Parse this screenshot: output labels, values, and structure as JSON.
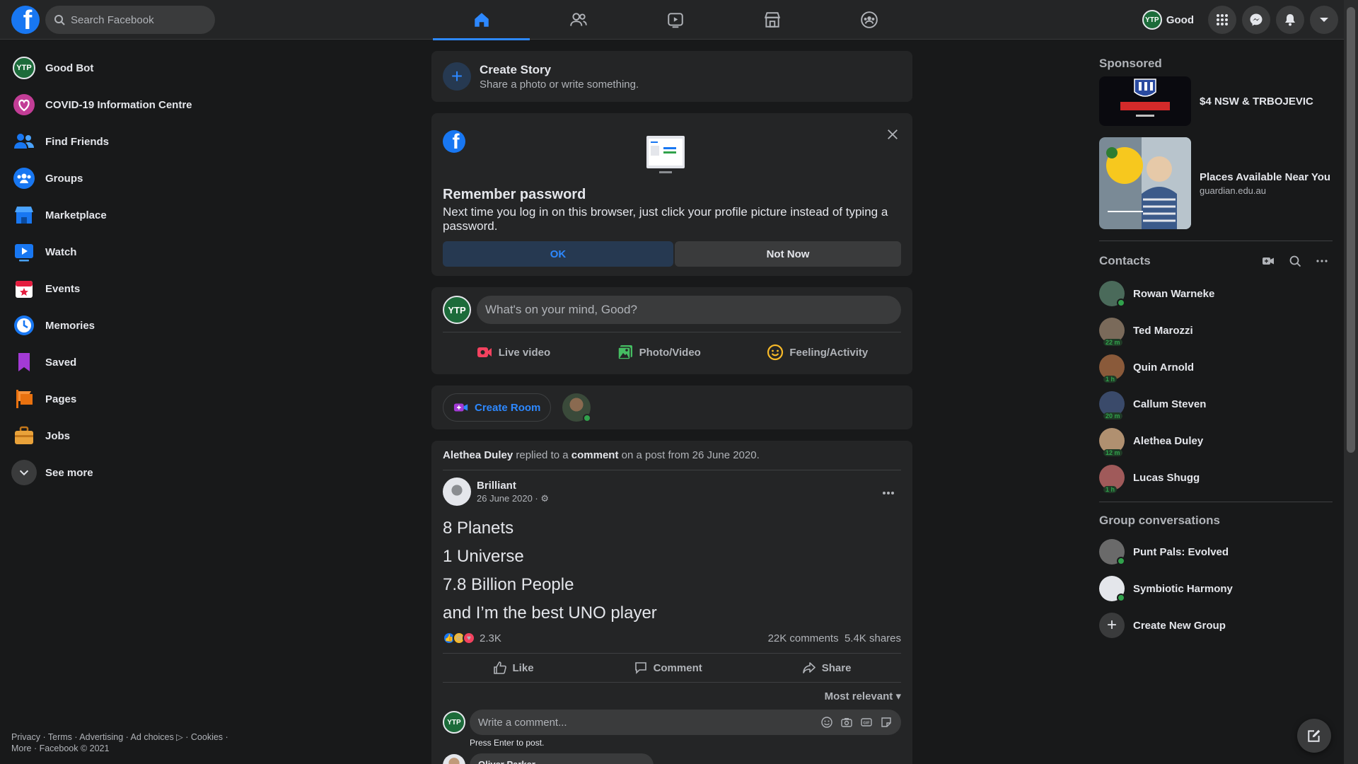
{
  "colors": {
    "accent": "#2d88ff",
    "brand": "#1877f2",
    "online": "#31a24c",
    "background": "#18191a",
    "card": "#242526"
  },
  "topbar": {
    "search_placeholder": "Search Facebook",
    "profile_name": "Good",
    "profile_badge": "YTP",
    "nav_icons": [
      "home-icon",
      "friends-icon",
      "watch-icon",
      "marketplace-icon",
      "groups-icon"
    ]
  },
  "sidebar": {
    "items": [
      {
        "label": "Good Bot",
        "icon": "avatar"
      },
      {
        "label": "COVID-19 Information Centre",
        "icon": "covid-icon"
      },
      {
        "label": "Find Friends",
        "icon": "friends-icon"
      },
      {
        "label": "Groups",
        "icon": "groups-icon"
      },
      {
        "label": "Marketplace",
        "icon": "marketplace-icon"
      },
      {
        "label": "Watch",
        "icon": "watch-icon"
      },
      {
        "label": "Events",
        "icon": "events-icon"
      },
      {
        "label": "Memories",
        "icon": "memories-icon"
      },
      {
        "label": "Saved",
        "icon": "saved-icon"
      },
      {
        "label": "Pages",
        "icon": "pages-icon"
      },
      {
        "label": "Jobs",
        "icon": "jobs-icon"
      },
      {
        "label": "See more",
        "icon": "chevron-down-icon"
      }
    ],
    "footer_line1": "Privacy · Terms · Advertising · Ad choices ▷ · Cookies ·",
    "footer_line2": "More · Facebook © 2021"
  },
  "story": {
    "title": "Create Story",
    "subtitle": "Share a photo or write something."
  },
  "password_prompt": {
    "title": "Remember password",
    "description": "Next time you log in on this browser, just click your profile picture instead of typing a password.",
    "ok_label": "OK",
    "not_now_label": "Not Now"
  },
  "composer": {
    "placeholder": "What's on your mind, Good?",
    "actions": [
      {
        "label": "Live video"
      },
      {
        "label": "Photo/Video"
      },
      {
        "label": "Feeling/Activity"
      }
    ]
  },
  "room": {
    "create_label": "Create Room"
  },
  "post": {
    "activity_actor": "Alethea Duley",
    "activity_mid": " replied to a ",
    "activity_comment": "comment",
    "activity_tail": " on a post from 26 June 2020.",
    "author": "Brilliant",
    "date": "26 June 2020 · ⚙",
    "lines": [
      "8 Planets",
      "1 Universe",
      "7.8 Billion People",
      "and I’m the best UNO player"
    ],
    "reactions_count": "2.3K",
    "comments_count": "22K comments",
    "shares_count": "5.4K shares",
    "like_label": "Like",
    "comment_label": "Comment",
    "share_label": "Share",
    "sort_label": "Most relevant",
    "comment_placeholder": "Write a comment...",
    "press_enter": "Press Enter to post.",
    "first_commenter": "Oliver Parker"
  },
  "right": {
    "sponsored_title": "Sponsored",
    "ads": [
      {
        "title": "$4 NSW & TRBOJEVIC",
        "site": ""
      },
      {
        "title": "Places Available Near You",
        "site": "guardian.edu.au"
      }
    ],
    "contacts_title": "Contacts",
    "contacts": [
      {
        "name": "Rowan Warneke",
        "status": "online",
        "away": "",
        "color": "#4a6a5a"
      },
      {
        "name": "Ted Marozzi",
        "status": "away",
        "away": "22 m",
        "color": "#7a6a5a"
      },
      {
        "name": "Quin Arnold",
        "status": "away",
        "away": "1 h",
        "color": "#8a5a3a"
      },
      {
        "name": "Callum Steven",
        "status": "away",
        "away": "20 m",
        "color": "#3a4a6a"
      },
      {
        "name": "Alethea Duley",
        "status": "away",
        "away": "12 m",
        "color": "#b09070"
      },
      {
        "name": "Lucas Shugg",
        "status": "away",
        "away": "1 h",
        "color": "#a05a5a"
      }
    ],
    "groups_title": "Group conversations",
    "groups": [
      {
        "name": "Punt Pals: Evolved",
        "color": "#6a6a6a"
      },
      {
        "name": "Symbiotic Harmony",
        "color": "#e4e6eb"
      }
    ],
    "create_group_label": "Create New Group"
  }
}
